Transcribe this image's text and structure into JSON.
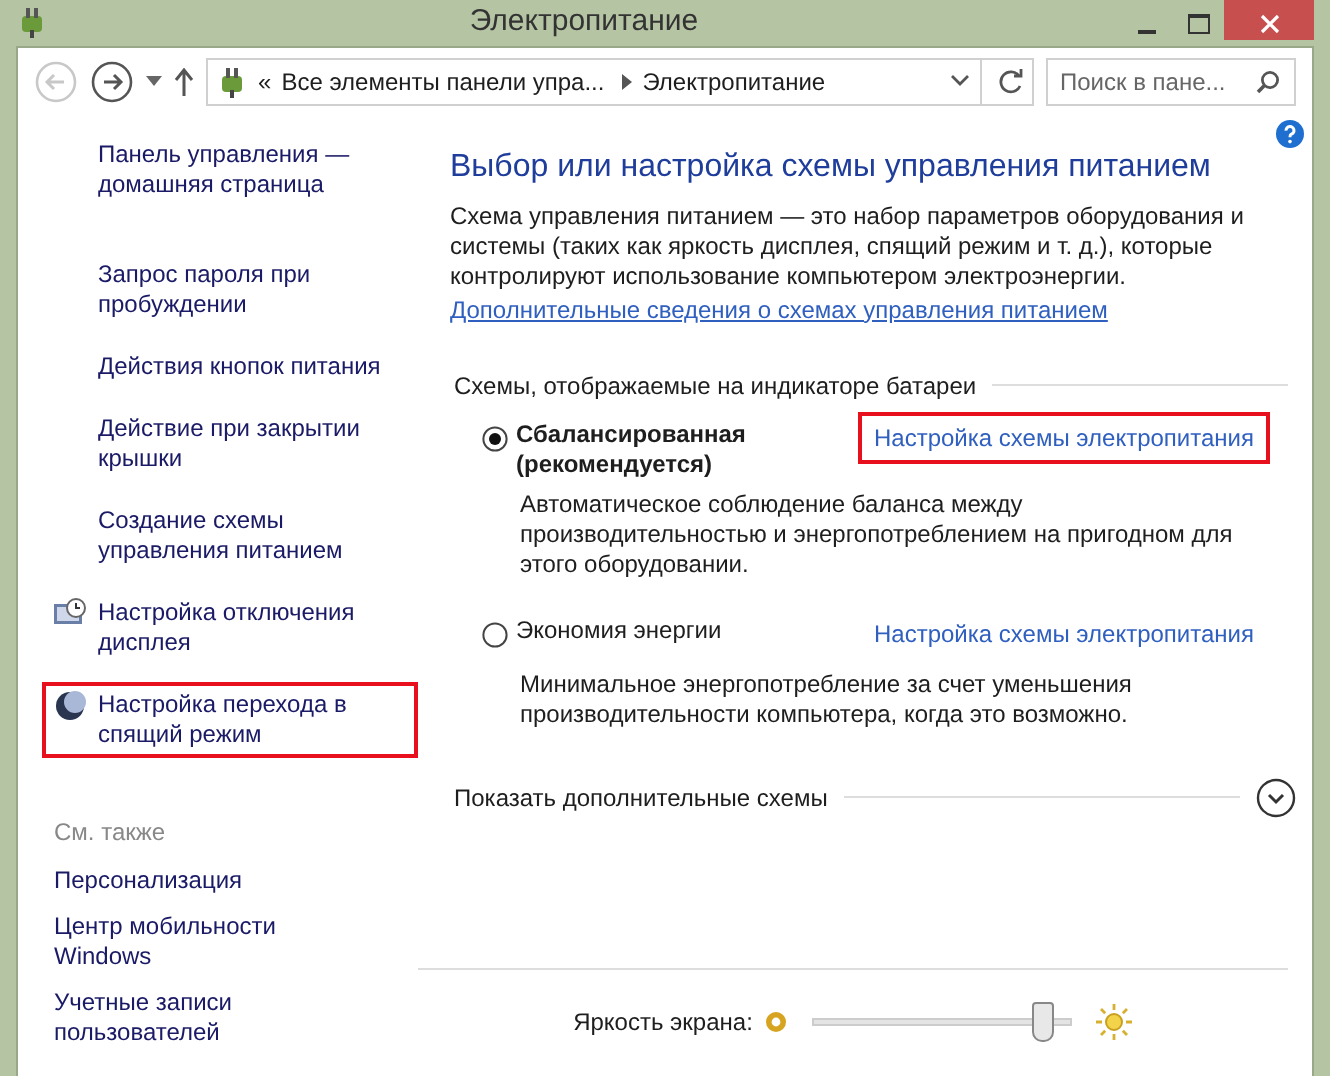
{
  "window": {
    "title": "Электропитание"
  },
  "address_bar": {
    "overflow_mark": "«",
    "crumbs": [
      "Все элементы панели упра...",
      "Электропитание"
    ]
  },
  "search": {
    "placeholder": "Поиск в пане..."
  },
  "sidebar": {
    "items": [
      {
        "label": "Панель управления — домашняя страница",
        "kind": "plain",
        "highlighted": false
      },
      {
        "label": "Запрос пароля при пробуждении",
        "kind": "plain",
        "highlighted": false
      },
      {
        "label": "Действия кнопок питания",
        "kind": "plain",
        "highlighted": false
      },
      {
        "label": "Действие при закрытии крышки",
        "kind": "plain",
        "highlighted": false
      },
      {
        "label": "Создание схемы управления питанием",
        "kind": "plain",
        "highlighted": false
      },
      {
        "label": "Настройка отключения дисплея",
        "kind": "display",
        "highlighted": false
      },
      {
        "label": "Настройка перехода в спящий режим",
        "kind": "sleep",
        "highlighted": true
      }
    ],
    "see_also": {
      "heading": "См. также",
      "items": [
        "Персонализация",
        "Центр мобильности Windows",
        "Учетные записи пользователей"
      ]
    }
  },
  "main": {
    "heading": "Выбор или настройка схемы управления питанием",
    "description": "Схема управления питанием — это набор параметров оборудования и системы (таких как яркость дисплея, спящий режим и т. д.), которые контролируют использование компьютером электроэнергии.",
    "more_link": "Дополнительные сведения о схемах управления питанием",
    "plans_section": "Схемы, отображаемые на индикаторе батареи",
    "plans": [
      {
        "name": "Сбалансированная (рекомендуется)",
        "selected": true,
        "link": "Настройка схемы электропитания",
        "link_highlighted": true,
        "description": "Автоматическое соблюдение баланса между производительностью и энергопотреблением на пригодном для этого оборудовании."
      },
      {
        "name": "Экономия энергии",
        "selected": false,
        "link": "Настройка схемы электропитания",
        "link_highlighted": false,
        "description": "Минимальное энергопотребление за счет уменьшения производительности компьютера, когда это возможно."
      }
    ],
    "show_more": "Показать дополнительные схемы",
    "brightness": {
      "label": "Яркость экрана:",
      "level": 0.88
    }
  }
}
